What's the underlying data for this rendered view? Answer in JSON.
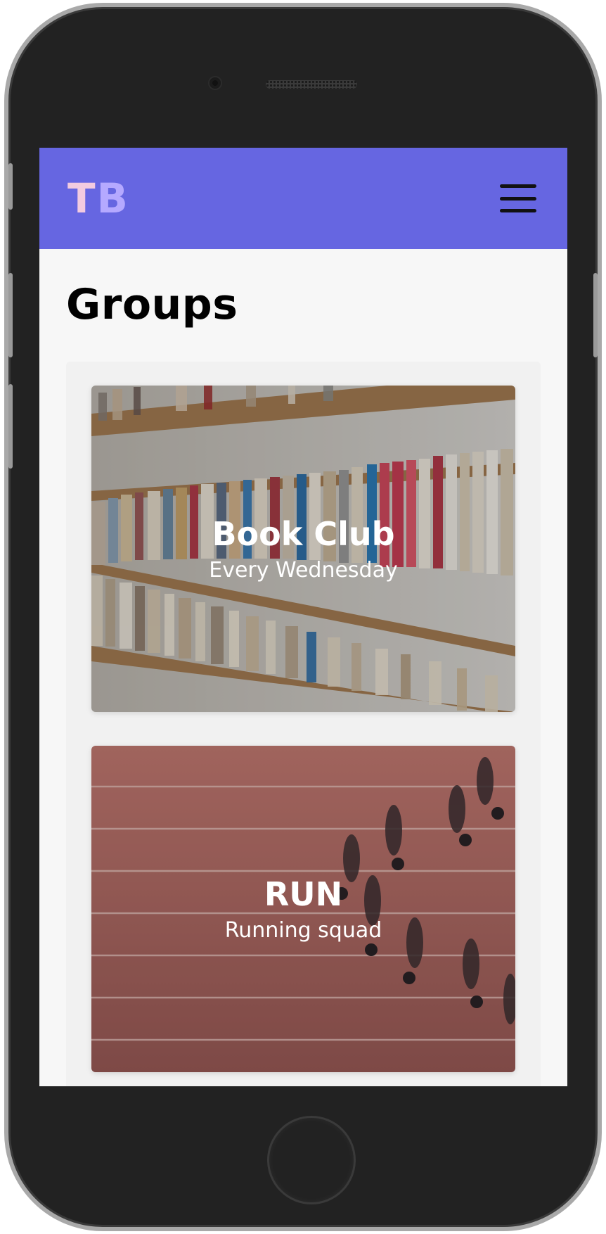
{
  "navbar": {
    "logo_part1": "T",
    "logo_part2": "B",
    "menu_icon": "hamburger-menu-icon",
    "color": "#6666e1"
  },
  "page": {
    "title": "Groups"
  },
  "groups": [
    {
      "title": "Book Club",
      "subtitle": "Every Wednesday",
      "image": "bookshelf-photo"
    },
    {
      "title": "RUN",
      "subtitle": "Running squad",
      "image": "running-track-photo"
    }
  ]
}
